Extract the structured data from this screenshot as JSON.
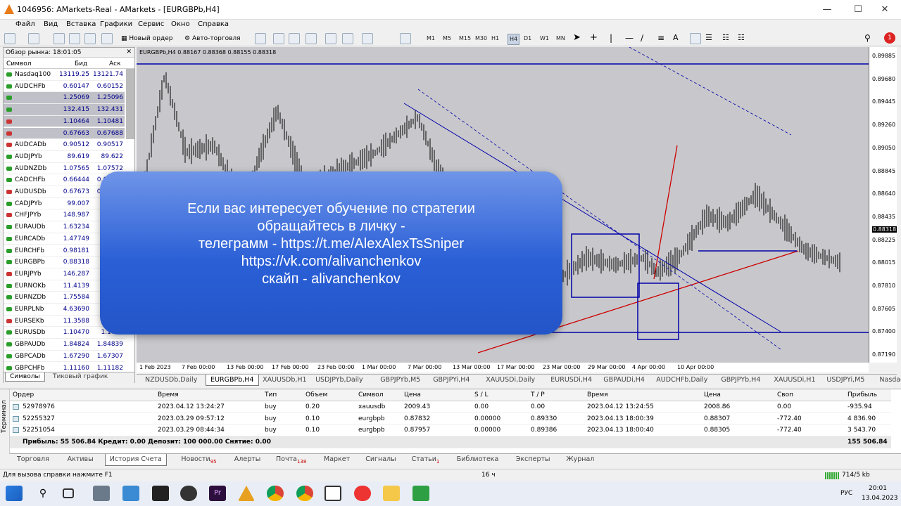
{
  "window": {
    "title": "1046956: AMarkets-Real - AMarkets - [EURGBPb,H4]"
  },
  "menu": [
    "Файл",
    "Вид",
    "Вставка",
    "Графики",
    "Сервис",
    "Окно",
    "Справка"
  ],
  "toolbar": {
    "new_order": "Новый ордер",
    "auto_trading": "Авто-торговля",
    "timeframes": [
      "M1",
      "M5",
      "M15",
      "M30",
      "H1",
      "H4",
      "D1",
      "W1",
      "MN"
    ]
  },
  "market_watch": {
    "title": "Обзор рынка: 18:01:05",
    "col_symbol": "Символ",
    "col_bid": "Бид",
    "col_ask": "Аск",
    "rows": [
      {
        "s": "Nasdaq100",
        "b": "13119.25",
        "a": "13121.74",
        "dir": "up"
      },
      {
        "s": "AUDCHFb",
        "b": "0.60147",
        "a": "0.60152",
        "dir": "up"
      },
      {
        "s": "",
        "b": "1.25069",
        "a": "1.25096",
        "dir": "up",
        "sel": true
      },
      {
        "s": "",
        "b": "132.415",
        "a": "132.431",
        "dir": "up",
        "sel": true
      },
      {
        "s": "",
        "b": "1.10464",
        "a": "1.10481",
        "dir": "dn",
        "sel": true
      },
      {
        "s": "",
        "b": "0.67663",
        "a": "0.67688",
        "dir": "dn",
        "sel": true
      },
      {
        "s": "AUDCADb",
        "b": "0.90512",
        "a": "0.90517",
        "dir": "dn"
      },
      {
        "s": "AUDJPYb",
        "b": "89.619",
        "a": "89.622",
        "dir": "up"
      },
      {
        "s": "AUDNZDb",
        "b": "1.07565",
        "a": "1.07572",
        "dir": "up"
      },
      {
        "s": "CADCHFb",
        "b": "0.66444",
        "a": "0.66451",
        "dir": "up"
      },
      {
        "s": "AUDUSDb",
        "b": "0.67673",
        "a": "0.67678",
        "dir": "dn"
      },
      {
        "s": "CADJPYb",
        "b": "99.007",
        "a": "",
        "dir": "up"
      },
      {
        "s": "CHFJPYb",
        "b": "148.987",
        "a": "",
        "dir": "dn"
      },
      {
        "s": "EURAUDb",
        "b": "1.63234",
        "a": "",
        "dir": "up"
      },
      {
        "s": "EURCADb",
        "b": "1.47749",
        "a": "",
        "dir": "up"
      },
      {
        "s": "EURCHFb",
        "b": "0.98181",
        "a": "",
        "dir": "up"
      },
      {
        "s": "EURGBPb",
        "b": "0.88318",
        "a": "",
        "dir": "up"
      },
      {
        "s": "EURJPYb",
        "b": "146.287",
        "a": "",
        "dir": "dn"
      },
      {
        "s": "EURNOKb",
        "b": "11.4139",
        "a": "",
        "dir": "up"
      },
      {
        "s": "EURNZDb",
        "b": "1.75584",
        "a": "",
        "dir": "up"
      },
      {
        "s": "EURPLNb",
        "b": "4.63690",
        "a": "",
        "dir": "up"
      },
      {
        "s": "EURSEKb",
        "b": "11.3588",
        "a": "",
        "dir": "dn"
      },
      {
        "s": "EURUSDb",
        "b": "1.10470",
        "a": "1.1047",
        "dir": "up"
      },
      {
        "s": "GBPAUDb",
        "b": "1.84824",
        "a": "1.84839",
        "dir": "up"
      },
      {
        "s": "GBPCADb",
        "b": "1.67290",
        "a": "1.67307",
        "dir": "up"
      },
      {
        "s": "GBPCHFb",
        "b": "1.11160",
        "a": "1.11182",
        "dir": "up"
      }
    ],
    "tab_symbols": "Символы",
    "tab_tick": "Тиковый график"
  },
  "chart": {
    "info": "EURGBPb,H4  0.88167 0.88368 0.88155 0.88318",
    "prices": [
      "0.89885",
      "0.89680",
      "0.89445",
      "0.89260",
      "0.89050",
      "0.88845",
      "0.88640",
      "0.88435",
      "0.88318",
      "0.88225",
      "0.88015",
      "0.87810",
      "0.87605",
      "0.87400",
      "0.87190"
    ],
    "dates": [
      "1 Feb 2023",
      "7 Feb 00:00",
      "13 Feb 00:00",
      "17 Feb 00:00",
      "23 Feb 00:00",
      "1 Mar 00:00",
      "7 Mar 00:00",
      "13 Mar 00:00",
      "17 Mar 00:00",
      "23 Mar 00:00",
      "29 Mar 00:00",
      "4 Apr 00:00",
      "10 Apr 00:00"
    ]
  },
  "overlay": [
    "Если вас интересует обучение по стратегии",
    "обращайтесь в личку -",
    "телеграмм  - https://t.me/AlexAlexTsSniper",
    "https://vk.com/alivanchenkov",
    "скайп - alivanchenkov"
  ],
  "symbol_tabs": [
    "NZDUSDb,Daily",
    "EURGBPb,H4",
    "XAUUSDb,H1",
    "USDJPYb,Daily",
    "GBPJPYb,M5",
    "GBPJPYi,H4",
    "XAUUSDi,Daily",
    "EURUSDi,H4",
    "GBPAUDi,H4",
    "AUDCHFb,Daily",
    "GBPJPYb,H4",
    "XAUUSDi,H1",
    "USDJPYi,M5",
    "Nasdaq1("
  ],
  "terminal": {
    "vertical": "Терминал",
    "headers": [
      "Ордер",
      "Время",
      "Тип",
      "Объем",
      "Символ",
      "Цена",
      "S / L",
      "T / P",
      "Время",
      "Цена",
      "Своп",
      "Прибыль"
    ],
    "rows": [
      [
        "52978976",
        "2023.04.12 13:24:27",
        "buy",
        "0.20",
        "xauusdb",
        "2009.43",
        "0.00",
        "0.00",
        "2023.04.12 13:24:55",
        "2008.86",
        "0.00",
        "-935.94"
      ],
      [
        "52255327",
        "2023.03.29 09:57:12",
        "buy",
        "0.10",
        "eurgbpb",
        "0.87832",
        "0.00000",
        "0.89330",
        "2023.04.13 18:00:39",
        "0.88307",
        "-772.40",
        "4 836.90"
      ],
      [
        "52251054",
        "2023.03.29 08:44:34",
        "buy",
        "0.10",
        "eurgbpb",
        "0.87957",
        "0.00000",
        "0.89386",
        "2023.04.13 18:00:40",
        "0.88305",
        "-772.40",
        "3 543.70"
      ]
    ],
    "summary": "Прибыль: 55 506.84  Кредит: 0.00  Депозит: 100 000.00  Снятие: 0.00",
    "total": "155 506.84"
  },
  "terminal_tabs": [
    {
      "l": "Торговля"
    },
    {
      "l": "Активы"
    },
    {
      "l": "История Счета",
      "active": true
    },
    {
      "l": "Новости",
      "n": "95"
    },
    {
      "l": "Алерты"
    },
    {
      "l": "Почта",
      "n": "138"
    },
    {
      "l": "Маркет"
    },
    {
      "l": "Сигналы"
    },
    {
      "l": "Статьи",
      "n": "1"
    },
    {
      "l": "Библиотека"
    },
    {
      "l": "Эксперты"
    },
    {
      "l": "Журнал"
    }
  ],
  "status": {
    "help": "Для вызова справки нажмите F1",
    "mid": "16 ч",
    "net": "714/5 kb"
  },
  "tray": {
    "lang": "РУС",
    "time": "20:01",
    "date": "13.04.2023"
  },
  "notify_count": "1"
}
